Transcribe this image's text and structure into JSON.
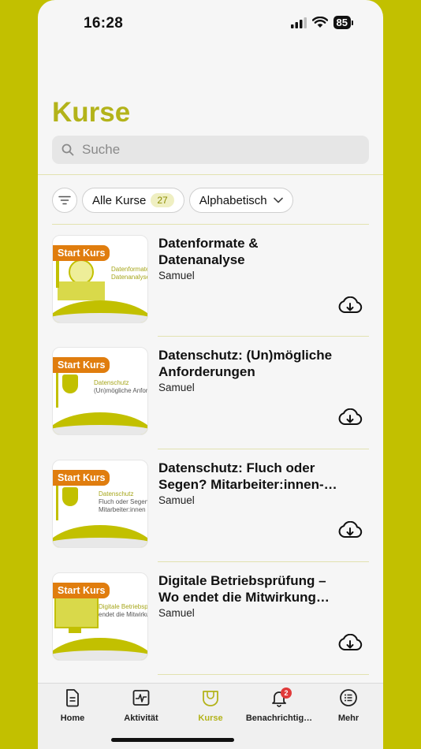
{
  "status": {
    "time": "16:28",
    "battery": "85"
  },
  "page": {
    "title": "Kurse"
  },
  "search": {
    "placeholder": "Suche",
    "icon": "search-icon"
  },
  "filters": {
    "all_label": "Alle Kurse",
    "all_count": "27",
    "sort_label": "Alphabetisch"
  },
  "courses": [
    {
      "title": "Datenformate & Datenanalyse",
      "author": "Samuel",
      "tag": "Start Kurs",
      "thumb_line1": "Datenformate",
      "thumb_line2": "Datenanalyse"
    },
    {
      "title": "Datenschutz: (Un)mögliche Anforderungen",
      "author": "Samuel",
      "tag": "Start Kurs",
      "thumb_line1": "Datenschutz",
      "thumb_line2": "(Un)mögliche Anforde"
    },
    {
      "title": "Datenschutz: Fluch oder Segen? Mitarbeiter:innen-…",
      "author": "Samuel",
      "tag": "Start Kurs",
      "thumb_line1": "Datenschutz",
      "thumb_line2": "Fluch oder Segen?",
      "thumb_line3": "Mitarbeiter:innen S"
    },
    {
      "title": "Digitale Betriebsprüfung – Wo endet die Mitwirkung…",
      "author": "Samuel",
      "tag": "Start Kurs",
      "thumb_line1": "Digitale Betriebsprü",
      "thumb_line2": "endet die Mitwirkungs"
    }
  ],
  "tabbar": {
    "items": [
      {
        "label": "Home",
        "icon": "document-icon"
      },
      {
        "label": "Aktivität",
        "icon": "activity-icon"
      },
      {
        "label": "Kurse",
        "icon": "courses-icon"
      },
      {
        "label": "Benachrichtig…",
        "icon": "bell-icon",
        "badge": "2"
      },
      {
        "label": "Mehr",
        "icon": "menu-icon"
      }
    ]
  },
  "colors": {
    "accent": "#b3b31a",
    "background": "#c2c000",
    "tag": "#e07d0e"
  }
}
